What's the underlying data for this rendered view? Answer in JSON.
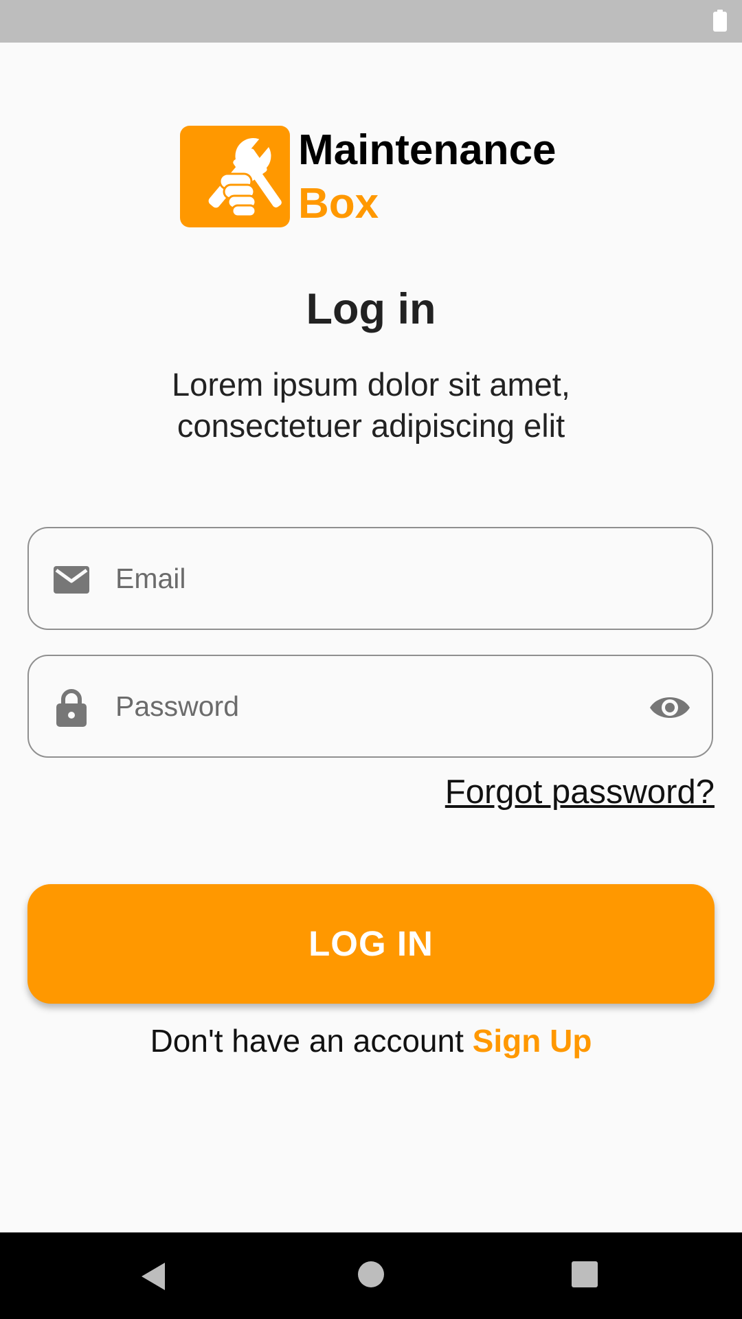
{
  "status_bar": {
    "battery_icon": "battery-full-icon"
  },
  "brand": {
    "logo_icon": "wrench-hand-icon",
    "line1": "Maintenance",
    "line2": "Box",
    "accent_color": "#ff9800"
  },
  "heading": {
    "title": "Log in",
    "subtitle": "Lorem ipsum dolor sit amet, consectetuer adipiscing elit"
  },
  "form": {
    "email": {
      "icon": "email-icon",
      "value": "",
      "placeholder": "Email"
    },
    "password": {
      "icon": "lock-icon",
      "value": "",
      "placeholder": "Password",
      "toggle_icon": "eye-icon"
    },
    "forgot_label": "Forgot password?",
    "submit_label": "LOG IN"
  },
  "signup": {
    "prompt": "Don't have an account",
    "link_label": "Sign Up"
  },
  "nav_bar": {
    "back_icon": "back-triangle-icon",
    "home_icon": "home-circle-icon",
    "recents_icon": "recents-square-icon"
  }
}
